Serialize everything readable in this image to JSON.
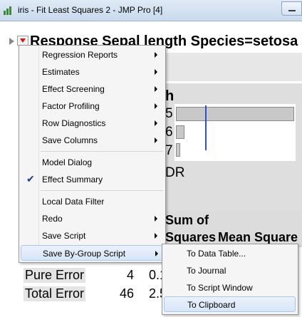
{
  "window": {
    "title": "iris - Fit Least Squares 2 - JMP Pro [4]"
  },
  "report": {
    "title": "Response Sepal length Species=setosa",
    "partial_header": "h",
    "row_numbers": [
      "5",
      "6",
      "7"
    ],
    "dr_text": "DR",
    "columns": {
      "sum_of": "Sum of",
      "squares": "Squares",
      "mean_square": "Mean Square"
    },
    "rows": [
      {
        "label": "Pure Error",
        "df": "4",
        "partial": "0.1"
      },
      {
        "label": "Total Error",
        "df": "46",
        "partial": "2.5"
      }
    ]
  },
  "context_menu": {
    "items": [
      {
        "label": "Regression Reports",
        "submenu": true
      },
      {
        "label": "Estimates",
        "submenu": true
      },
      {
        "label": "Effect Screening",
        "submenu": true
      },
      {
        "label": "Factor Profiling",
        "submenu": true
      },
      {
        "label": "Row Diagnostics",
        "submenu": true
      },
      {
        "label": "Save Columns",
        "submenu": true
      },
      {
        "label": "Model Dialog",
        "submenu": false
      },
      {
        "label": "Effect Summary",
        "submenu": false,
        "checked": true
      },
      {
        "label": "Local Data Filter",
        "submenu": false
      },
      {
        "label": "Redo",
        "submenu": true
      },
      {
        "label": "Save Script",
        "submenu": true
      },
      {
        "label": "Save By-Group Script",
        "submenu": true,
        "highlighted": true
      }
    ]
  },
  "submenu": {
    "items": [
      {
        "label": "To Data Table..."
      },
      {
        "label": "To Journal"
      },
      {
        "label": "To Script Window"
      },
      {
        "label": "To Clipboard",
        "highlighted": true
      }
    ]
  },
  "icons": {
    "app": "jmp-app-icon",
    "disclosure": "disclosure-triangle-icon",
    "red_triangle": "red-triangle-menu-icon",
    "check": "checkmark-icon",
    "submenu_arrow": "submenu-arrow-icon"
  },
  "colors": {
    "highlight": "#d7e6f8",
    "red_triangle": "#dd1111",
    "blue_line": "#3050c8"
  }
}
